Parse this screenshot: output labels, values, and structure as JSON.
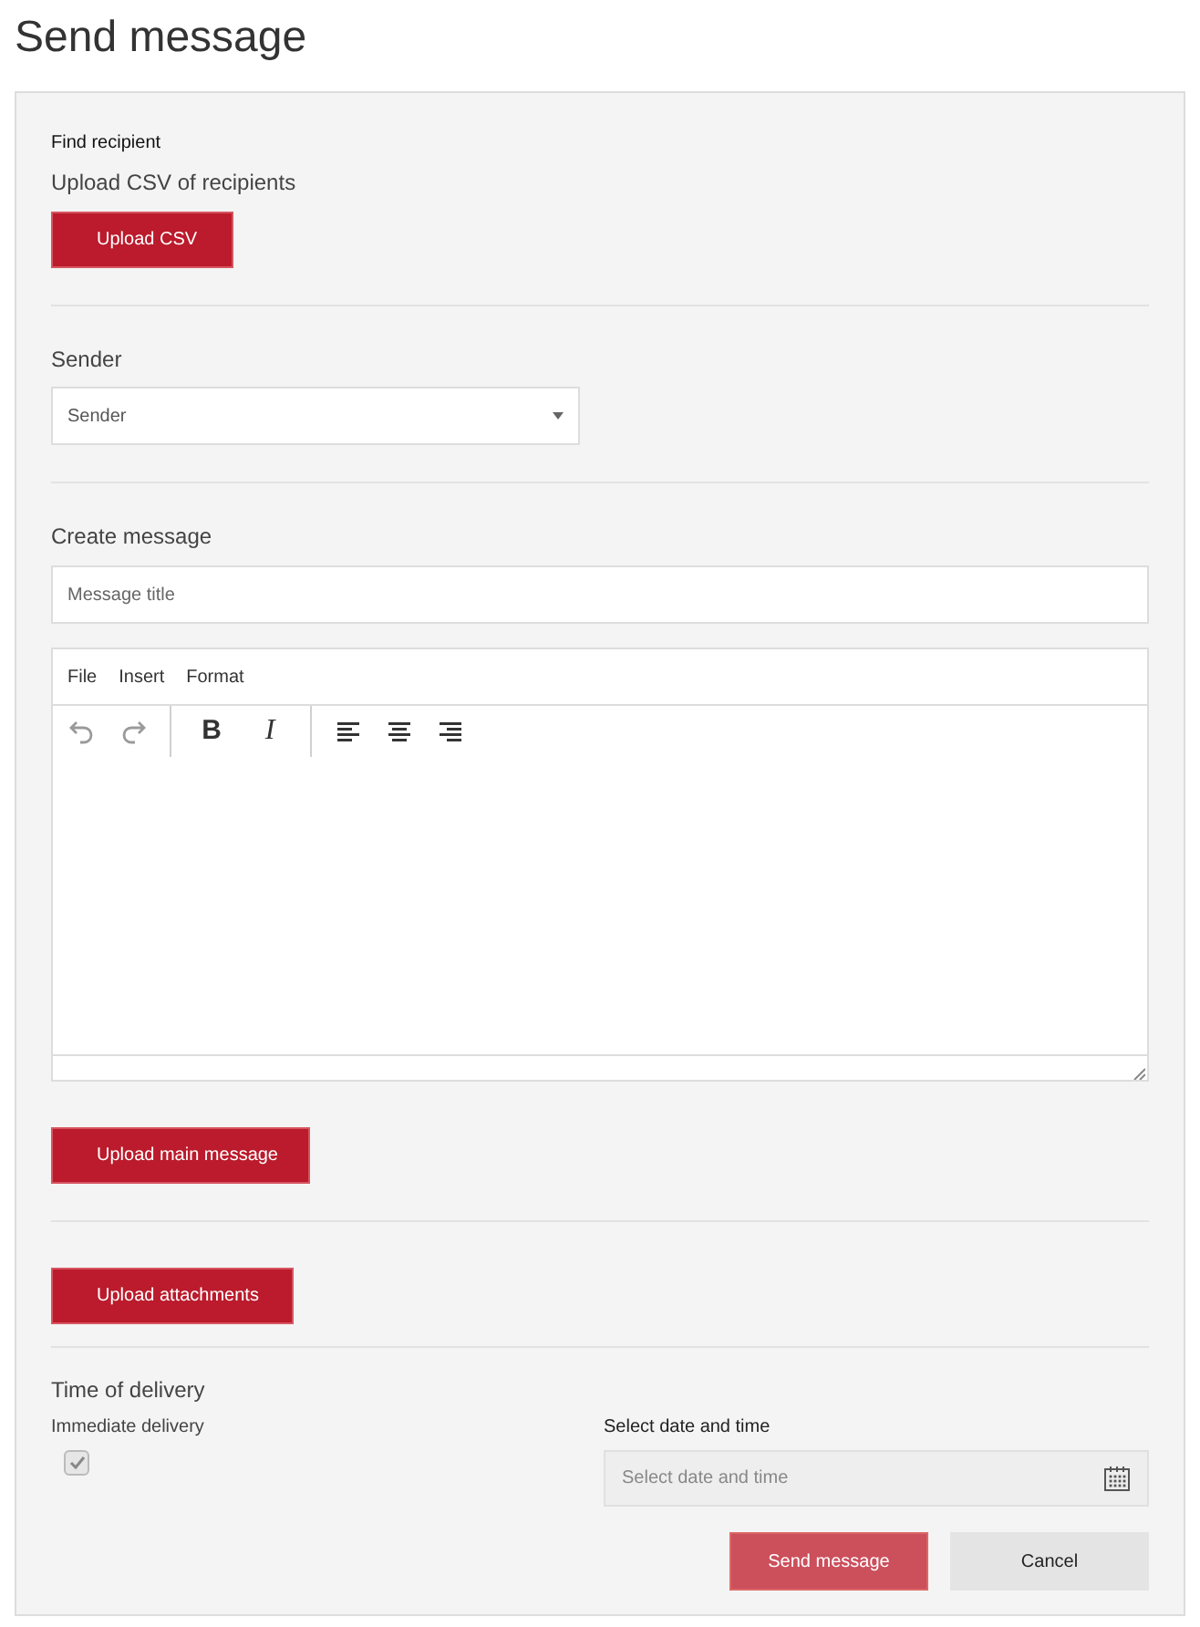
{
  "page_title": "Send message",
  "recipient": {
    "heading": "Find recipient",
    "label": "Upload CSV of recipients",
    "button": "Upload CSV"
  },
  "sender": {
    "label": "Sender",
    "select_value": "Sender"
  },
  "message": {
    "label": "Create message",
    "title_placeholder": "Message title",
    "editor": {
      "menu": [
        "File",
        "Insert",
        "Format"
      ],
      "tools": [
        {
          "kind": "undo",
          "disabled": true
        },
        {
          "kind": "redo",
          "disabled": true
        },
        {
          "kind": "sep"
        },
        {
          "kind": "bold",
          "label": "B",
          "disabled": false
        },
        {
          "kind": "italic",
          "label": "I",
          "disabled": false
        },
        {
          "kind": "sep"
        },
        {
          "kind": "align-left",
          "disabled": false
        },
        {
          "kind": "align-center",
          "disabled": false
        },
        {
          "kind": "align-right",
          "disabled": false
        }
      ]
    },
    "upload_button": "Upload main message"
  },
  "attachments": {
    "button": "Upload attachments"
  },
  "delivery": {
    "label": "Time of delivery",
    "immediate_label": "Immediate delivery",
    "immediate_checked": true,
    "immediate_disabled": true,
    "date_label": "Select date and time",
    "date_placeholder": "Select date and time",
    "date_disabled": true
  },
  "actions": [
    {
      "label": "Send message",
      "kind": "primary",
      "disabled": true
    },
    {
      "label": "Cancel",
      "kind": "secondary",
      "disabled": false
    }
  ]
}
